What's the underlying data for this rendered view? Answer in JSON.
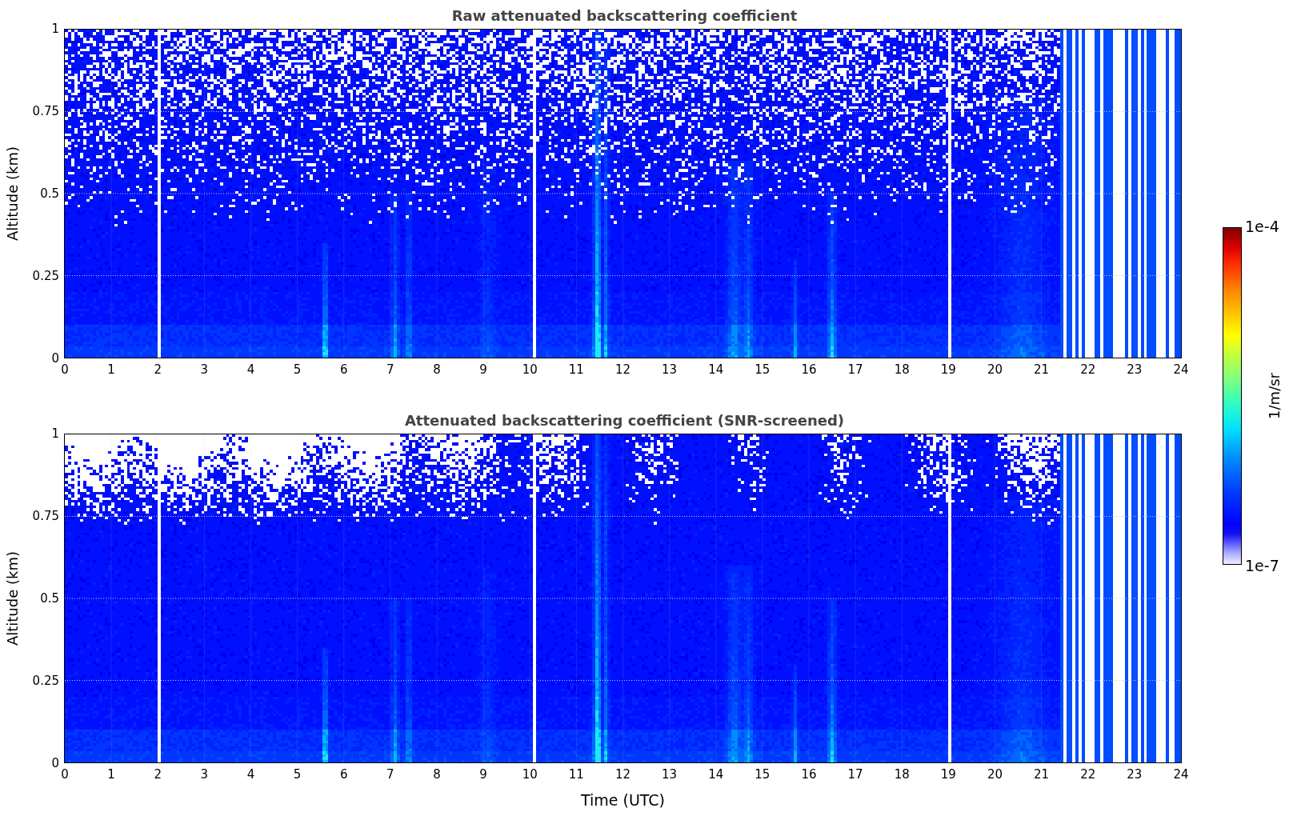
{
  "panels": [
    {
      "kind": "raw",
      "title": "Raw attenuated backscattering coefficient",
      "y_axis": {
        "label": "Altitude (km)",
        "ticks": [
          "1",
          "0.75",
          "0.5",
          "0.25",
          "0"
        ]
      },
      "x_axis": {
        "ticks": [
          "0",
          "1",
          "2",
          "3",
          "4",
          "5",
          "6",
          "7",
          "8",
          "9",
          "10",
          "11",
          "12",
          "13",
          "14",
          "15",
          "16",
          "17",
          "18",
          "19",
          "20",
          "21",
          "22",
          "23",
          "24"
        ]
      }
    },
    {
      "kind": "screened",
      "title": "Attenuated backscattering coefficient (SNR-screened)",
      "y_axis": {
        "label": "Altitude (km)",
        "ticks": [
          "1",
          "0.75",
          "0.5",
          "0.25",
          "0"
        ]
      },
      "x_axis": {
        "label": "Time (UTC)",
        "ticks": [
          "0",
          "1",
          "2",
          "3",
          "4",
          "5",
          "6",
          "7",
          "8",
          "9",
          "10",
          "11",
          "12",
          "13",
          "14",
          "15",
          "16",
          "17",
          "18",
          "19",
          "20",
          "21",
          "22",
          "23",
          "24"
        ]
      }
    }
  ],
  "colorbar": {
    "label": "1/m/sr",
    "max_label": "1e-4",
    "min_label": "1e-7"
  }
}
